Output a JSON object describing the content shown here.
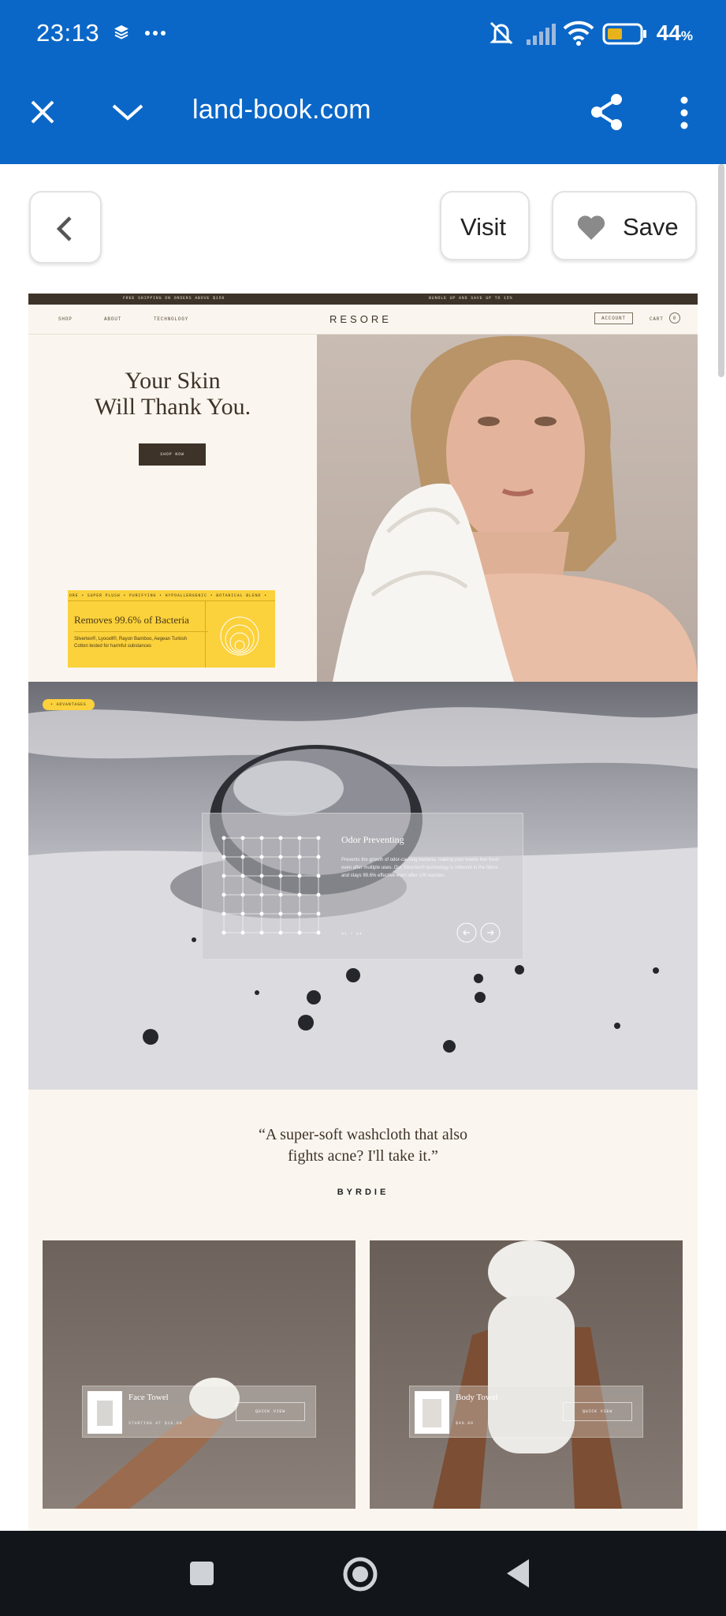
{
  "status_bar": {
    "time": "23:13",
    "battery_percent": "44",
    "battery_suffix": "%",
    "icons": [
      "layers-icon",
      "more-dots-icon",
      "mute-icon",
      "signal-icon",
      "wifi-icon",
      "battery-icon"
    ]
  },
  "browser_toolbar": {
    "url": "land-book.com",
    "icons": [
      "close-icon",
      "chevron-down-icon",
      "share-icon",
      "more-vert-icon"
    ]
  },
  "landbook": {
    "visit_label": "Visit",
    "save_label": "Save"
  },
  "resore": {
    "announcement_left": "FREE SHIPPING ON ORDERS ABOVE $150",
    "announcement_right": "BUNDLE UP AND SAVE UP TO 15%",
    "nav_shop": "SHOP",
    "nav_about": "ABOUT",
    "nav_technology": "TECHNOLOGY",
    "logo": "RESORE",
    "account": "ACCOUNT",
    "cart": "CART",
    "cart_count": "0",
    "hero_title_line1": "Your Skin",
    "hero_title_line2": "Will Thank You.",
    "shop_now": "SHOP NOW",
    "ticker": "ORE • SUPER PLUSH • PURIFYING • HYPOALLERGENIC • BOTANICAL BLEND •",
    "card_title": "Removes 99.6% of Bacteria",
    "card_body": "Silvertex®, Lyocell®, Rayon Bamboo, Aegean Turkish Cotton tested for harmful substances",
    "advantages_badge": "• ADVANTAGES",
    "odor_title": "Odor Preventing",
    "odor_body": "Prevents the growth of odor-causing bacteria, making your towels feel fresh even after multiple uses. Our Silvertex® technology is inherent in the fibres and stays 99.6% effective even after 100 washes.",
    "odor_counter": "01 / 04",
    "quote_line1": "“A super-soft washcloth that also",
    "quote_line2": "fights acne? I'll take it.”",
    "quote_source": "BYRDIE",
    "product1_name": "Face Towel",
    "product1_price": "STARTING AT $18.00",
    "product1_cta": "QUICK VIEW",
    "product2_name": "Body Towel",
    "product2_price": "$40.00",
    "product2_cta": "QUICK VIEW"
  },
  "nav_bar": {
    "icons": [
      "recents-square-icon",
      "home-circle-icon",
      "back-triangle-icon"
    ]
  },
  "colors": {
    "browser_blue": "#0b67c7",
    "resore_cream": "#faf6ef",
    "resore_brown": "#3e3328",
    "resore_yellow": "#fbd13c"
  }
}
